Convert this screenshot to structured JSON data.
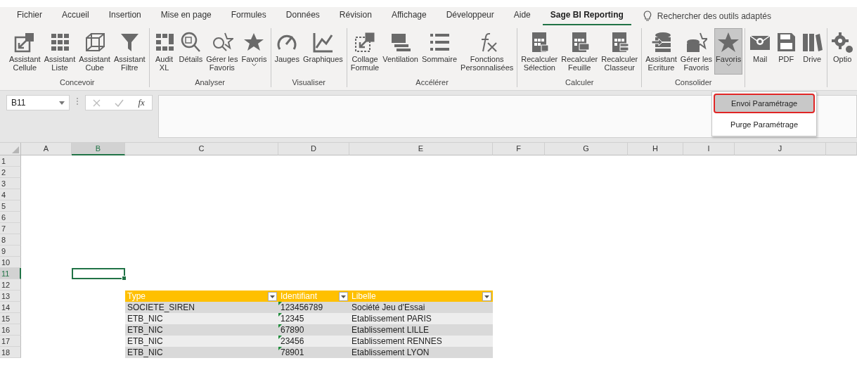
{
  "menu_tabs": [
    {
      "label": "Fichier",
      "selected": false
    },
    {
      "label": "Accueil",
      "selected": false
    },
    {
      "label": "Insertion",
      "selected": false
    },
    {
      "label": "Mise en page",
      "selected": false
    },
    {
      "label": "Formules",
      "selected": false
    },
    {
      "label": "Données",
      "selected": false
    },
    {
      "label": "Révision",
      "selected": false
    },
    {
      "label": "Affichage",
      "selected": false
    },
    {
      "label": "Développeur",
      "selected": false
    },
    {
      "label": "Aide",
      "selected": false
    },
    {
      "label": "Sage BI Reporting",
      "selected": true
    }
  ],
  "tell_me": {
    "placeholder": "Rechercher des outils adaptés"
  },
  "ribbon_groups": [
    {
      "label": "Concevoir",
      "buttons": [
        {
          "label": "Assistant\nCellule",
          "dropdown": false,
          "pressed": false
        },
        {
          "label": "Assistant\nListe",
          "dropdown": false,
          "pressed": false
        },
        {
          "label": "Assistant\nCube",
          "dropdown": false,
          "pressed": false
        },
        {
          "label": "Assistant\nFiltre",
          "dropdown": false,
          "pressed": false
        }
      ]
    },
    {
      "label": "Analyser",
      "buttons": [
        {
          "label": "Audit\nXL",
          "dropdown": false,
          "pressed": false
        },
        {
          "label": "Détails",
          "dropdown": false,
          "pressed": false
        },
        {
          "label": "Gérer les\nFavoris",
          "dropdown": false,
          "pressed": false
        },
        {
          "label": "Favoris",
          "dropdown": true,
          "pressed": false
        }
      ]
    },
    {
      "label": "Visualiser",
      "buttons": [
        {
          "label": "Jauges",
          "dropdown": false,
          "pressed": false
        },
        {
          "label": "Graphiques",
          "dropdown": false,
          "pressed": false
        }
      ]
    },
    {
      "label": "Accélérer",
      "buttons": [
        {
          "label": "Collage\nFormule",
          "dropdown": false,
          "pressed": false
        },
        {
          "label": "Ventilation",
          "dropdown": false,
          "pressed": false
        },
        {
          "label": "Sommaire",
          "dropdown": false,
          "pressed": false
        },
        {
          "label": "Fonctions\nPersonnalisées",
          "dropdown": false,
          "pressed": false
        }
      ]
    },
    {
      "label": "Calculer",
      "buttons": [
        {
          "label": "Recalculer\nSélection",
          "dropdown": false,
          "pressed": false
        },
        {
          "label": "Recalculer\nFeuille",
          "dropdown": false,
          "pressed": false
        },
        {
          "label": "Recalculer\nClasseur",
          "dropdown": false,
          "pressed": false
        }
      ]
    },
    {
      "label": "Consolider",
      "buttons": [
        {
          "label": "Assistant\nEcriture",
          "dropdown": false,
          "pressed": false
        },
        {
          "label": "Gérer les\nFavoris",
          "dropdown": false,
          "pressed": false
        },
        {
          "label": "Favoris",
          "dropdown": true,
          "pressed": true
        }
      ]
    },
    {
      "buttons": [
        {
          "label": "Mail",
          "dropdown": false,
          "pressed": false
        },
        {
          "label": "PDF",
          "dropdown": false,
          "pressed": false
        },
        {
          "label": "Drive",
          "dropdown": false,
          "pressed": false
        }
      ]
    },
    {
      "buttons": [
        {
          "label": "Optio",
          "dropdown": false,
          "pressed": false
        }
      ]
    }
  ],
  "dropdown_menu": {
    "items": [
      {
        "label": "Envoi Paramétrage",
        "selected": true
      },
      {
        "label": "Purge Paramétrage",
        "selected": false
      }
    ]
  },
  "name_box": {
    "value": "B11"
  },
  "function_symbol": "fx",
  "sheet": {
    "columns": [
      {
        "label": "A",
        "selected": false
      },
      {
        "label": "B",
        "selected": true
      },
      {
        "label": "C",
        "selected": false
      },
      {
        "label": "D",
        "selected": false
      },
      {
        "label": "E",
        "selected": false
      },
      {
        "label": "F",
        "selected": false
      },
      {
        "label": "G",
        "selected": false
      },
      {
        "label": "H",
        "selected": false
      },
      {
        "label": "I",
        "selected": false
      },
      {
        "label": "J",
        "selected": false
      }
    ],
    "rows": [
      {
        "label": "1",
        "selected": false
      },
      {
        "label": "2",
        "selected": false
      },
      {
        "label": "3",
        "selected": false
      },
      {
        "label": "4",
        "selected": false
      },
      {
        "label": "5",
        "selected": false
      },
      {
        "label": "6",
        "selected": false
      },
      {
        "label": "7",
        "selected": false
      },
      {
        "label": "8",
        "selected": false
      },
      {
        "label": "9",
        "selected": false
      },
      {
        "label": "10",
        "selected": false
      },
      {
        "label": "11",
        "selected": true
      },
      {
        "label": "12",
        "selected": false
      },
      {
        "label": "13",
        "selected": false
      },
      {
        "label": "14",
        "selected": false
      },
      {
        "label": "15",
        "selected": false
      },
      {
        "label": "16",
        "selected": false
      },
      {
        "label": "17",
        "selected": false
      },
      {
        "label": "18",
        "selected": false
      }
    ],
    "table": {
      "columns": [
        {
          "label": "Type",
          "text_number_flag": false
        },
        {
          "label": "Identifiant",
          "text_number_flag": true
        },
        {
          "label": "Libelle",
          "text_number_flag": false
        }
      ],
      "rows": [
        [
          "SOCIETE_SIREN",
          "123456789",
          "Société Jeu d'Essai"
        ],
        [
          "ETB_NIC",
          "12345",
          "Etablissement PARIS"
        ],
        [
          "ETB_NIC",
          "67890",
          "Etablissement LILLE"
        ],
        [
          "ETB_NIC",
          "23456",
          "Etablissement RENNES"
        ],
        [
          "ETB_NIC",
          "78901",
          "Etablissement LYON"
        ]
      ]
    }
  }
}
